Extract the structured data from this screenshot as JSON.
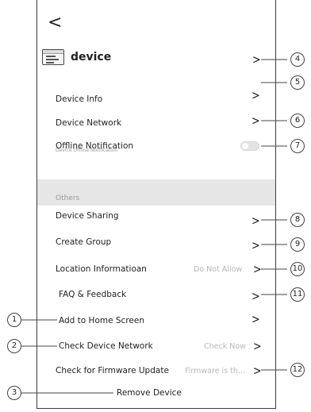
{
  "header": {
    "back_glyph": "<"
  },
  "device": {
    "name": "device",
    "icon": "device-icon"
  },
  "rows": {
    "device_info": {
      "label": "Device Info"
    },
    "device_network": {
      "label": "Device Network"
    },
    "offline_caption": "Device Offline  Notification",
    "offline_notification": {
      "label": "Offline  Notification",
      "toggle_on": false
    },
    "others_section": "Others",
    "device_sharing": {
      "label": "Device Sharing"
    },
    "create_group": {
      "label": "Create Group"
    },
    "location_info": {
      "label": "Location Informatioan",
      "value": "Do Not Allow"
    },
    "faq": {
      "label": "FAQ & Feedback"
    },
    "add_home": {
      "label": "Add to Home Screen"
    },
    "check_network": {
      "label": "Check Device Network",
      "value": "Check Now"
    },
    "firmware": {
      "label": "Check for Firmware Update",
      "value": "Firmware is th..."
    },
    "remove": {
      "label": "Remove Device"
    }
  },
  "chevron": ">",
  "callouts": [
    "1",
    "2",
    "3",
    "4",
    "5",
    "6",
    "7",
    "8",
    "9",
    "10",
    "11",
    "12"
  ],
  "colors": {
    "section_band": "#e6e6e6",
    "value_text": "#b8b8b8",
    "frame": "#3c3c3c"
  }
}
